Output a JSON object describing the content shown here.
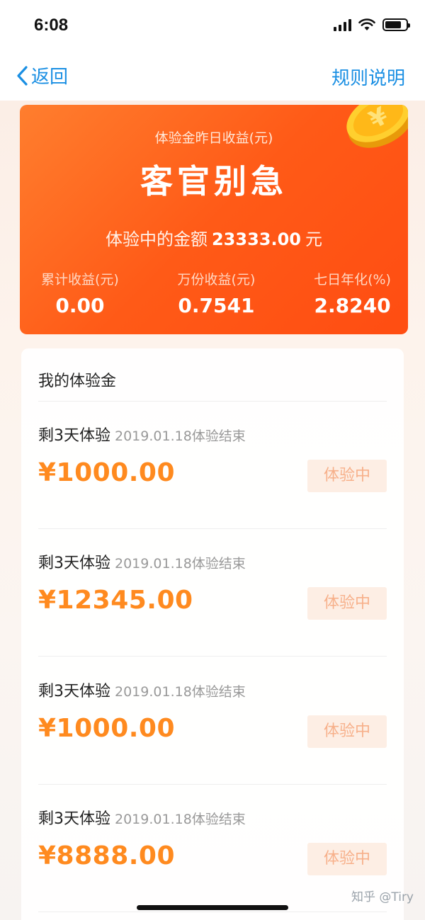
{
  "status_bar": {
    "time": "6:08"
  },
  "nav": {
    "back_label": "返回",
    "rules_label": "规则说明"
  },
  "hero": {
    "subtitle": "体验金昨日收益(元)",
    "title": "客官别急",
    "amount_prefix": "体验中的金额",
    "amount_value": "23333.00",
    "amount_unit": "元",
    "stats": [
      {
        "label": "累计收益(元)",
        "value": "0.00"
      },
      {
        "label": "万份收益(元)",
        "value": "0.7541"
      },
      {
        "label": "七日年化(%)",
        "value": "2.8240"
      }
    ]
  },
  "list": {
    "header": "我的体验金",
    "items": [
      {
        "title": "剩3天体验",
        "date": "2019.01.18体验结束",
        "amount": "¥1000.00",
        "badge": "体验中"
      },
      {
        "title": "剩3天体验",
        "date": "2019.01.18体验结束",
        "amount": "¥12345.00",
        "badge": "体验中"
      },
      {
        "title": "剩3天体验",
        "date": "2019.01.18体验结束",
        "amount": "¥1000.00",
        "badge": "体验中"
      },
      {
        "title": "剩3天体验",
        "date": "2019.01.18体验结束",
        "amount": "¥8888.00",
        "badge": "体验中"
      }
    ]
  },
  "watermark": "知乎 @Tiry",
  "colors": {
    "accent_blue": "#1a8fe3",
    "hero_orange": "#ff5a17",
    "amount_orange": "#ff8a1f",
    "badge_bg": "#fdeee4"
  }
}
